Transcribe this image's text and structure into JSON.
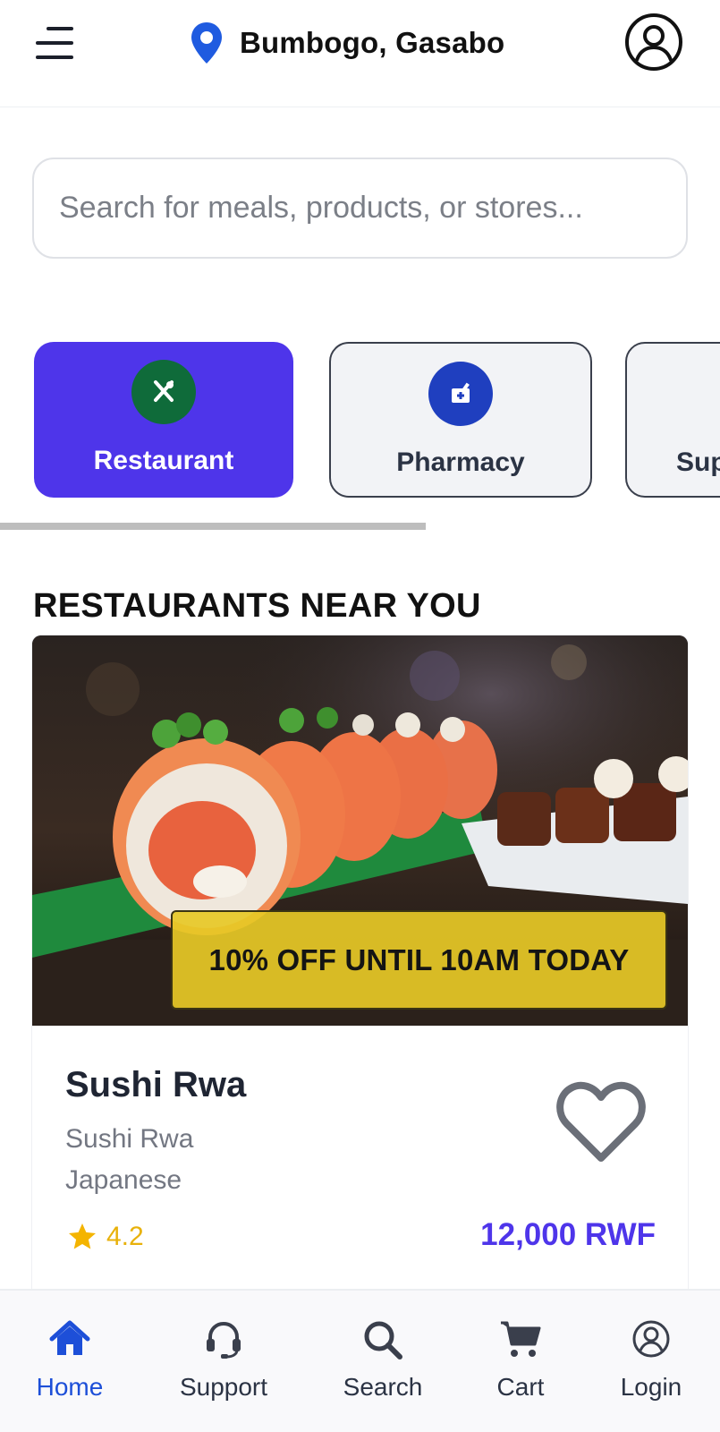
{
  "header": {
    "location": "Bumbogo, Gasabo",
    "menu_icon": "hamburger-icon",
    "location_icon": "map-pin-icon",
    "profile_icon": "user-circle-icon"
  },
  "search": {
    "placeholder": "Search for meals, products, or stores..."
  },
  "categories": [
    {
      "label": "Restaurant",
      "icon": "utensils-icon",
      "active": true,
      "icon_bg": "#0f6b3a"
    },
    {
      "label": "Pharmacy",
      "icon": "mortar-pestle-icon",
      "active": false,
      "icon_bg": "#1f3fbf"
    },
    {
      "label": "Sup",
      "icon": "",
      "active": false
    }
  ],
  "section": {
    "title": "RESTAURANTS NEAR YOU"
  },
  "restaurant": {
    "promo": "10% OFF UNTIL 10AM TODAY",
    "name": "Sushi Rwa",
    "subtitle": "Sushi Rwa",
    "cuisine": "Japanese",
    "rating": "4.2",
    "price": "12,000 RWF",
    "image": "sushi-rolls-photo",
    "favorite_icon": "heart-outline-icon"
  },
  "bottom_nav": [
    {
      "label": "Home",
      "icon": "home-icon",
      "active": true
    },
    {
      "label": "Support",
      "icon": "headset-icon",
      "active": false
    },
    {
      "label": "Search",
      "icon": "search-icon",
      "active": false
    },
    {
      "label": "Cart",
      "icon": "cart-icon",
      "active": false
    },
    {
      "label": "Login",
      "icon": "user-circle-icon",
      "active": false
    }
  ],
  "colors": {
    "accent": "#4e35ea",
    "nav_active": "#1d4fd8",
    "promo_bg": "#e7c926",
    "rating": "#e8b10b"
  }
}
